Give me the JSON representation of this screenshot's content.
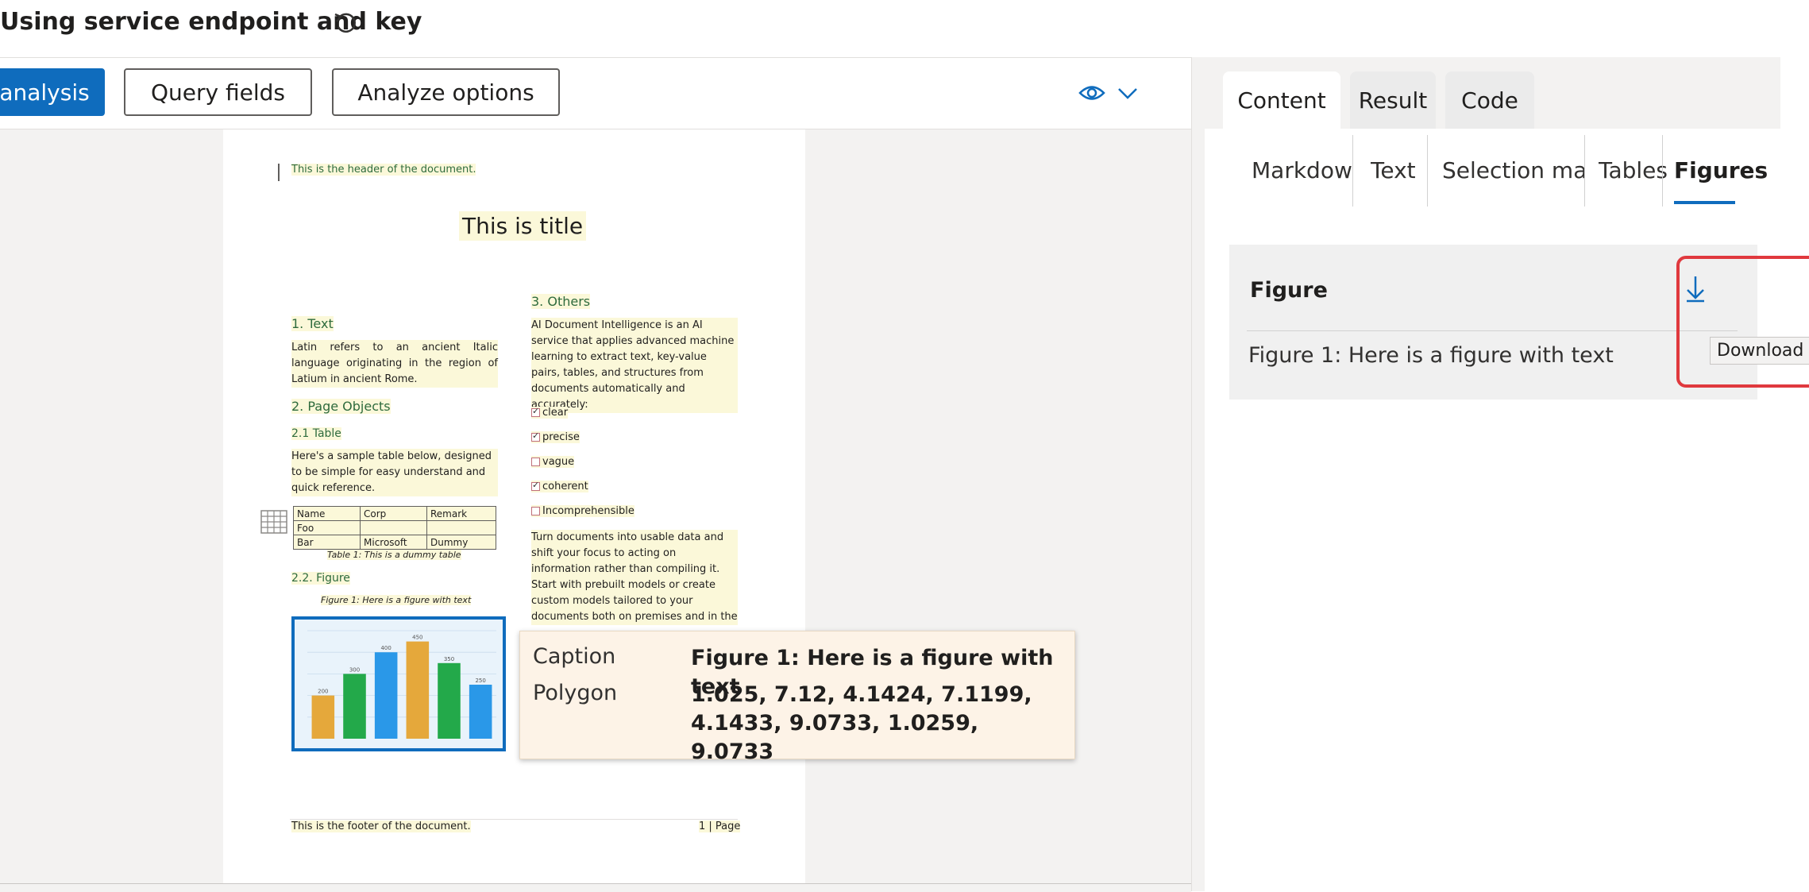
{
  "header": {
    "title": "Using service endpoint and key",
    "refresh_icon": "undo-icon"
  },
  "toolbar": {
    "analysis_label": "analysis",
    "query_fields_label": "Query fields",
    "analyze_options_label": "Analyze options",
    "view_icon": "eye-icon",
    "dropdown_icon": "chevron-down-icon"
  },
  "document": {
    "header_text": "This is the header of the document.",
    "title": "This is title",
    "sec1_heading": "1. Text",
    "sec1_body": "Latin refers to an ancient Italic language originating in the region of Latium in ancient Rome.",
    "sec2_heading": "2. Page Objects",
    "sec21_heading": "2.1 Table",
    "sec21_body": "Here's a sample table below, designed to be simple for easy understand and quick reference.",
    "table": {
      "rows": [
        [
          "Name",
          "Corp",
          "Remark"
        ],
        [
          "Foo",
          "",
          ""
        ],
        [
          "Bar",
          "Microsoft",
          "Dummy"
        ]
      ],
      "caption": "Table 1: This is a dummy table"
    },
    "sec22_heading": "2.2. Figure",
    "figure_caption": "Figure 1: Here is a figure with text",
    "sec3_heading": "3. Others",
    "sec3_body": "AI Document Intelligence is an AI service that applies advanced machine learning to extract text, key-value pairs, tables, and structures from documents automatically and accurately:",
    "checkboxes": [
      {
        "label": "clear",
        "checked": true
      },
      {
        "label": "precise",
        "checked": true
      },
      {
        "label": "vague",
        "checked": false
      },
      {
        "label": "coherent",
        "checked": true
      },
      {
        "label": "Incomprehensible",
        "checked": false
      }
    ],
    "sec3_body2": "Turn documents into usable data and shift your focus to acting on information rather than compiling it. Start with prebuilt models or create custom models tailored to your documents both on premises and in the cloud with the AI",
    "footer_text": "This is the footer of the document.",
    "page_label": "1 | Page"
  },
  "figure_chart": {
    "values": [
      200,
      300,
      400,
      450,
      350,
      250
    ],
    "labels": [
      "200",
      "300",
      "400",
      "450",
      "350",
      "250"
    ],
    "colors": [
      "#e5a83b",
      "#23a94a",
      "#2a98e8",
      "#e5a83b",
      "#23a94a",
      "#2a98e8"
    ],
    "ymax": 500
  },
  "info_card": {
    "caption_label": "Caption",
    "caption_value": "Figure 1: Here is a figure with text",
    "polygon_label": "Polygon",
    "polygon_value": "1.025, 7.12, 4.1424, 7.1199, 4.1433, 9.0733, 1.0259, 9.0733"
  },
  "right_panel": {
    "tabs": [
      "Content",
      "Result",
      "Code"
    ],
    "subtabs": [
      "Markdown",
      "Text",
      "Selection marks",
      "Tables",
      "Figures"
    ],
    "figure_card": {
      "title": "Figure",
      "item": "Figure 1: Here is a figure with text",
      "download_icon": "download-icon",
      "download_tooltip": "Download"
    }
  },
  "colors": {
    "accent": "#0f6cbd",
    "highlight_border": "#e0393e",
    "doc_highlight": "#fbf8d9",
    "card_bg": "#fdf3e7"
  }
}
